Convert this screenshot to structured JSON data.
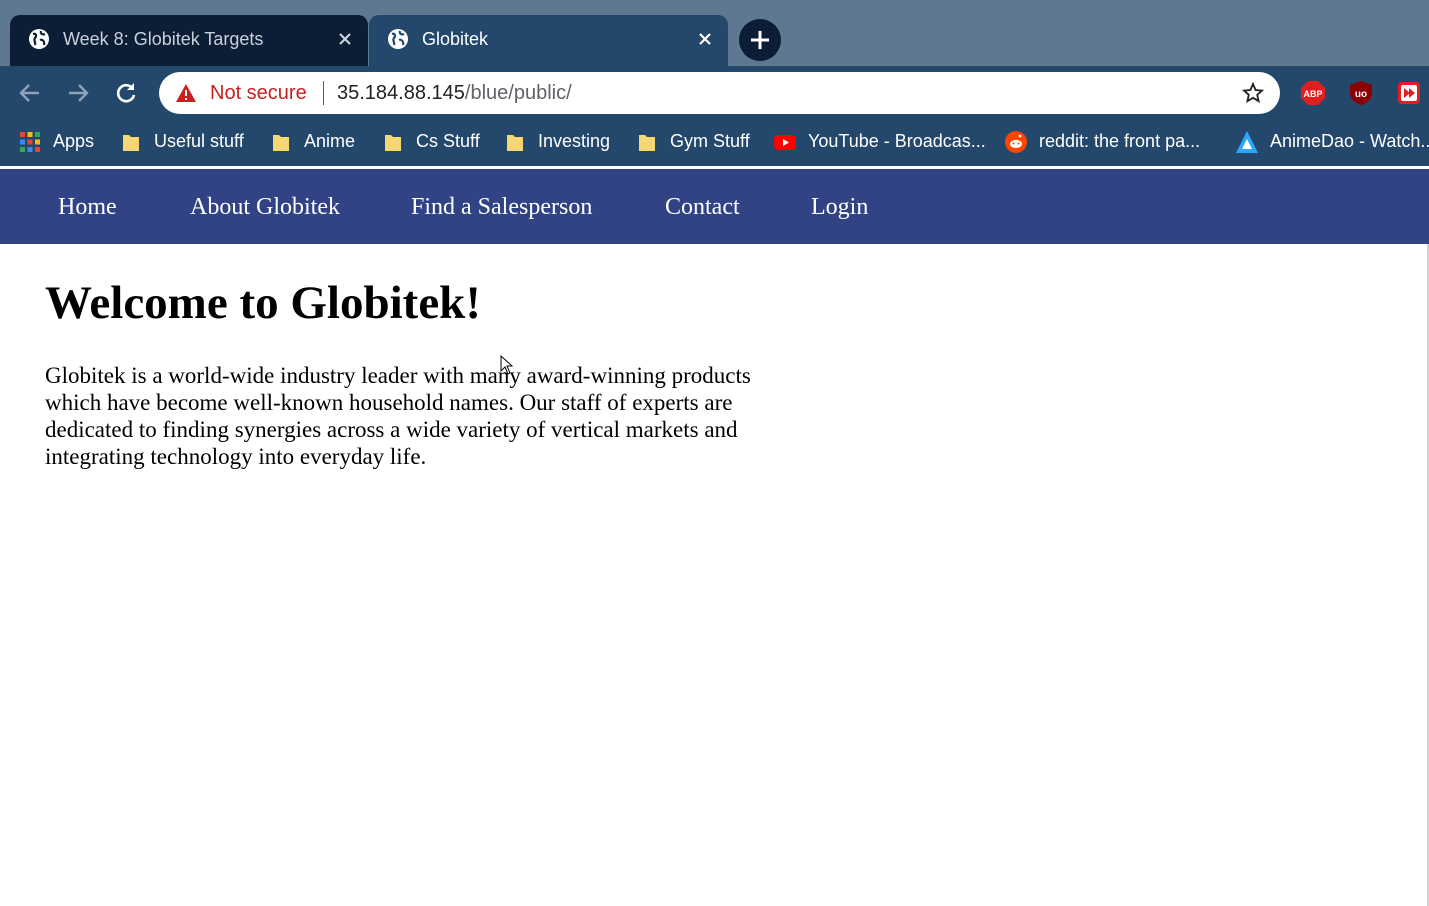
{
  "browser": {
    "tabs": [
      {
        "title": "Week 8: Globitek Targets",
        "active": false
      },
      {
        "title": "Globitek",
        "active": true
      }
    ],
    "omnibox": {
      "security_label": "Not secure",
      "url_host": "35.184.88.145",
      "url_path": "/blue/public/"
    },
    "extensions": [
      "abp-icon",
      "ublock-icon",
      "media-icon"
    ],
    "bookmarks": [
      {
        "label": "Apps",
        "icon": "apps-grid-icon"
      },
      {
        "label": "Useful stuff",
        "icon": "folder-icon"
      },
      {
        "label": "Anime",
        "icon": "folder-icon"
      },
      {
        "label": "Cs Stuff",
        "icon": "folder-icon"
      },
      {
        "label": "Investing",
        "icon": "folder-icon"
      },
      {
        "label": "Gym Stuff",
        "icon": "folder-icon"
      },
      {
        "label": "YouTube - Broadcas...",
        "icon": "youtube-icon"
      },
      {
        "label": "reddit: the front pa...",
        "icon": "reddit-icon"
      },
      {
        "label": "AnimeDao - Watch...",
        "icon": "animedao-icon"
      }
    ]
  },
  "site": {
    "nav": [
      "Home",
      "About Globitek",
      "Find a Salesperson",
      "Contact",
      "Login"
    ],
    "heading": "Welcome to Globitek!",
    "intro": "Globitek is a world-wide industry leader with many award-winning products which have become well-known household names. Our staff of experts are dedicated to finding synergies across a wide variety of vertical markets and integrating technology into everyday life."
  },
  "colors": {
    "tabstrip": "#5f7892",
    "toolbar": "#24476c",
    "site_nav": "#324385",
    "warning": "#c5221f"
  }
}
